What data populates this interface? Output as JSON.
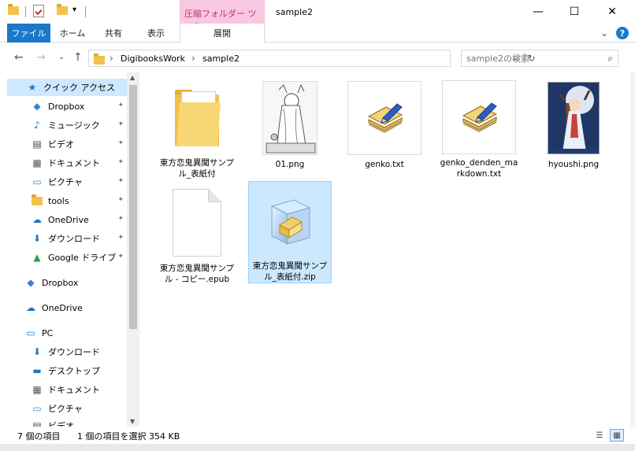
{
  "titlebar": {
    "context_tab_label": "圧縮フォルダー ツール",
    "window_title": "sample2",
    "minimize_glyph": "—",
    "maximize_glyph": "☐",
    "close_glyph": "✕",
    "qa_dropdown_glyph": "▾"
  },
  "ribbon": {
    "tabs": [
      "ファイル",
      "ホーム",
      "共有",
      "表示"
    ],
    "manage_tab": "展開",
    "expand_glyph": "⌄",
    "help_glyph": "?"
  },
  "address": {
    "back_glyph": "←",
    "forward_glyph": "→",
    "recent_glyph": "⌄",
    "up_glyph": "↑",
    "crumbs": [
      "DigibooksWork",
      "sample2"
    ],
    "crumb_sep": "›",
    "dropdown_glyph": "⌄",
    "refresh_glyph": "↻",
    "search_placeholder": "sample2の検索",
    "search_glyph": "⌕"
  },
  "nav": {
    "quick_access": "クイック アクセス",
    "items": [
      {
        "label": "Dropbox",
        "icon": "dropbox-icon",
        "pinned": true
      },
      {
        "label": "ミュージック",
        "icon": "music-icon",
        "pinned": true
      },
      {
        "label": "ビデオ",
        "icon": "video-icon",
        "pinned": true
      },
      {
        "label": "ドキュメント",
        "icon": "document-icon",
        "pinned": true
      },
      {
        "label": "ピクチャ",
        "icon": "picture-icon",
        "pinned": true
      },
      {
        "label": "tools",
        "icon": "folder-icon",
        "pinned": true
      },
      {
        "label": "OneDrive",
        "icon": "onedrive-icon",
        "pinned": true
      },
      {
        "label": "ダウンロード",
        "icon": "download-icon",
        "pinned": true
      },
      {
        "label": "Google ドライブ",
        "icon": "google-drive-icon",
        "pinned": true
      }
    ],
    "root_dropbox": "Dropbox",
    "root_onedrive": "OneDrive",
    "root_pc": "PC",
    "pc_items": [
      {
        "label": "ダウンロード",
        "icon": "download-icon"
      },
      {
        "label": "デスクトップ",
        "icon": "desktop-icon"
      },
      {
        "label": "ドキュメント",
        "icon": "document-icon"
      },
      {
        "label": "ピクチャ",
        "icon": "picture-icon"
      },
      {
        "label": "ビデオ",
        "icon": "video-icon"
      }
    ],
    "pin_glyph": "📌"
  },
  "files": [
    {
      "name": "東方恋鬼異聞サンプル_表紙付",
      "type": "folder"
    },
    {
      "name": "01.png",
      "type": "image"
    },
    {
      "name": "genko.txt",
      "type": "text"
    },
    {
      "name": "genko_denden_markdown.txt",
      "type": "text"
    },
    {
      "name": "hyoushi.png",
      "type": "image-color"
    },
    {
      "name": "東方恋鬼異聞サンプル - コピー.epub",
      "type": "blank"
    },
    {
      "name": "東方恋鬼異聞サンプル_表紙付.zip",
      "type": "zip",
      "selected": true
    }
  ],
  "status": {
    "item_count": "7 個の項目",
    "selection": "1 個の項目を選択 354 KB"
  },
  "colors": {
    "accent": "#1979ca",
    "selection": "#cce8ff",
    "context_tab": "#f8c8e0"
  }
}
